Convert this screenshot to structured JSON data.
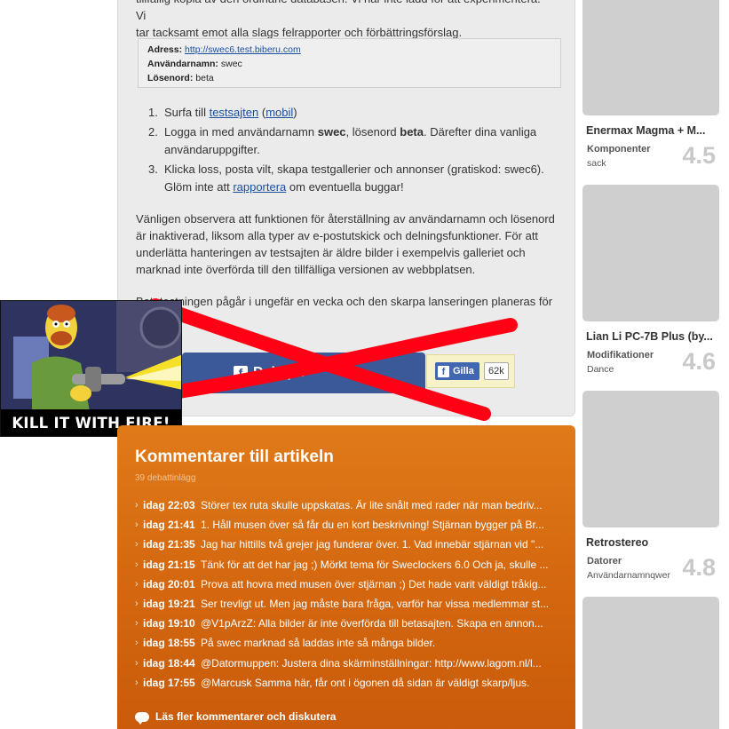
{
  "article": {
    "intro_line1": "tillfällig kopia av den ordinarie databasen. Vi har inte ladd för att experimentera. Vi",
    "intro_line2": "tar tacksamt emot alla slags felrapporter och förbättringsförslag.",
    "info": {
      "address_label": "Adress:",
      "address_value": "http://swec6.test.biberu.com",
      "username_label": "Användarnamn:",
      "username_value": "swec",
      "password_label": "Lösenord:",
      "password_value": "beta"
    },
    "steps": [
      {
        "num": "1.",
        "pre": "Surfa till ",
        "link1": "testsajten",
        "mid": " (",
        "link2": "mobil",
        "post": ")"
      },
      {
        "num": "2.",
        "text_a": "Logga in med användarnamn ",
        "bold_a": "swec",
        "text_b": ", lösenord ",
        "bold_b": "beta",
        "text_c": ". Därefter dina vanliga användaruppgifter."
      },
      {
        "num": "3.",
        "pre": "Klicka loss, posta vilt, skapa testgallerier och annonser (gratiskod: swec6). Glöm inte att ",
        "link": "rapportera",
        "post": " om eventuella buggar!"
      }
    ],
    "notice": "Vänligen observera att funktionen för återställning av användarnamn och lösenord är inaktiverad, liksom alla typer av e-postutskick och delningsfunktioner. För att underlätta hanteringen av testsajten är äldre bilder i exempelvis galleriet och marknad inte överförda till den tillfälliga versionen av webbplatsen.",
    "notice2": "Betatestningen pågår i ungefär en vecka och den skarpa lanseringen planeras för",
    "share_label": "Dela på",
    "like_label": "Gilla",
    "like_count": "62k"
  },
  "meme": {
    "caption": "KILL IT WITH FIRE!"
  },
  "comments": {
    "title": "Kommentarer till artikeln",
    "count": "39 debattinlägg",
    "items": [
      {
        "time": "idag 22:03",
        "text": "Störer tex ruta skulle uppskatas. Är lite snålt med rader när man bedriv..."
      },
      {
        "time": "idag 21:41",
        "text": "1. Håll musen över så får du en kort beskrivning! Stjärnan bygger på Br..."
      },
      {
        "time": "idag 21:35",
        "text": "Jag har hittills två grejer jag funderar över. 1. Vad innebär stjärnan vid \"..."
      },
      {
        "time": "idag 21:15",
        "text": "Tänk för att det har jag ;) Mörkt tema för Sweclockers 6.0 Och ja, skulle ..."
      },
      {
        "time": "idag 20:01",
        "text": "Prova att hovra med musen över stjärnan ;) Det hade varit väldigt tråkig..."
      },
      {
        "time": "idag 19:21",
        "text": "Ser trevligt ut. Men jag måste bara fråga, varför har vissa medlemmar st..."
      },
      {
        "time": "idag 19:10",
        "text": "@V1pArzZ: Alla bilder är inte överförda till betasajten. Skapa en annon..."
      },
      {
        "time": "idag 18:55",
        "text": "På swec marknad så laddas inte så många bilder."
      },
      {
        "time": "idag 18:44",
        "text": "@Datormuppen: Justera dina skärminställningar: http://www.lagom.nl/l..."
      },
      {
        "time": "idag 17:55",
        "text": "@Marcusk Samma här, får ont i ögonen då sidan är väldigt skarp/ljus."
      }
    ],
    "read_more": "Läs fler kommentarer och diskutera"
  },
  "sidebar": {
    "products": [
      {
        "name": "Enermax Magma + M...",
        "category": "Komponenter",
        "user": "sack",
        "score": "4.5"
      },
      {
        "name": "Lian Li PC-7B Plus (by...",
        "category": "Modifikationer",
        "user": "Dance",
        "score": "4.6"
      },
      {
        "name": "Retrostereo",
        "category": "Datorer",
        "user": "Användarnamnqwer",
        "score": "4.8"
      },
      {
        "name": "",
        "category": "",
        "user": "",
        "score": ""
      }
    ]
  },
  "colors": {
    "accent_orange": "#d4670f",
    "facebook_blue": "#3b5998",
    "cross_red": "#ff0015"
  }
}
